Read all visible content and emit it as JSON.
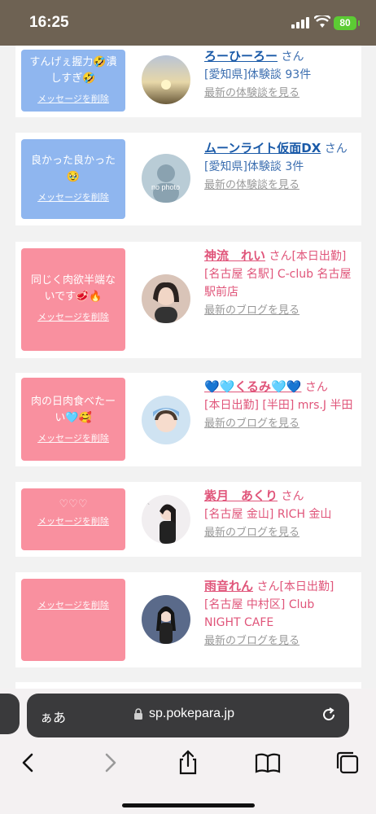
{
  "status": {
    "time": "16:25",
    "battery": "80"
  },
  "cards": [
    {
      "style": "blue",
      "message": "すんげぇ握力🤣潰しすぎ🤣",
      "delete_label": "メッセージを削除",
      "name": "ろーひーろー",
      "san": "さん",
      "detail": "[愛知県]体験談 93件",
      "latest": "最新の体験談を見る",
      "avatar": "sunset-avatar"
    },
    {
      "style": "blue",
      "message": "良かった良かった🥹",
      "delete_label": "メッセージを削除",
      "name": "ムーンライト仮面DX",
      "san": "さん",
      "detail": "[愛知県]体験談 3件",
      "latest": "最新の体験談を見る",
      "avatar": "no-photo-avatar"
    },
    {
      "style": "pink",
      "message": "同じく肉欲半端ないです🥩🔥",
      "delete_label": "メッセージを削除",
      "name": "神流　れい",
      "san": "さん[本日出勤]",
      "detail": "[名古屋 名駅] C-club 名古屋駅前店",
      "latest": "最新のブログを見る",
      "avatar": "woman-avatar"
    },
    {
      "style": "pink",
      "message": "肉の日肉食べたーい🩵🥰",
      "delete_label": "メッセージを削除",
      "name": "💙🩵くるみ🩵💙",
      "san": "さん",
      "detail": "[本日出勤] [半田] mrs.J 半田",
      "latest": "最新のブログを見る",
      "avatar": "woman-avatar"
    },
    {
      "style": "pink",
      "message": "♡♡♡",
      "delete_label": "メッセージを削除",
      "name": "紫月　あくり",
      "san": "さん",
      "detail": "[名古屋 金山] RICH 金山",
      "latest": "最新のブログを見る",
      "avatar": "woman-avatar"
    },
    {
      "style": "pink",
      "message": "",
      "delete_label": "メッセージを削除",
      "name": "雨音れん",
      "san": "さん[本日出勤]",
      "detail": "[名古屋 中村区] Club NIGHT CAFE",
      "latest": "最新のブログを見る",
      "avatar": "woman-avatar"
    }
  ],
  "browser": {
    "aa": "ぁあ",
    "url": "sp.pokepara.jp"
  },
  "colors": {
    "blue_bubble": "#8fb6ef",
    "pink_bubble": "#f9909f",
    "status_bg": "#6e6253"
  }
}
